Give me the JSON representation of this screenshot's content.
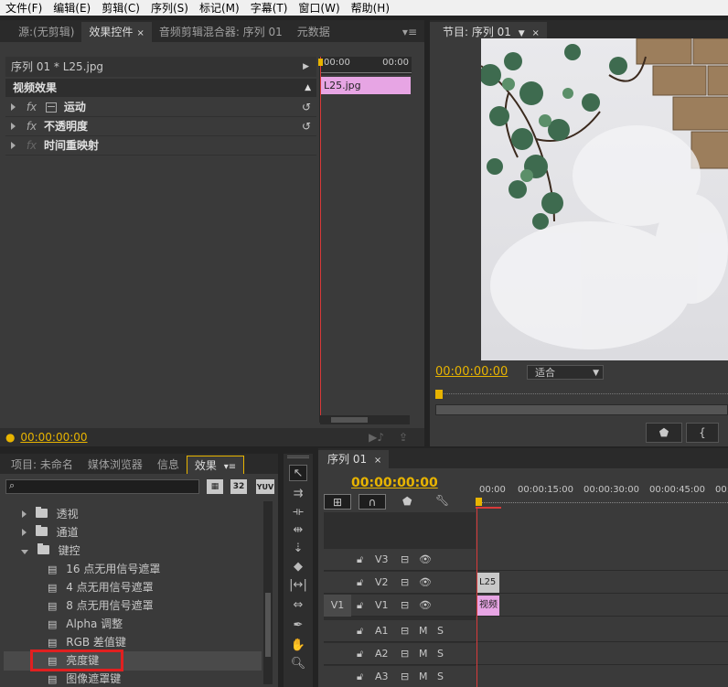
{
  "menu": [
    "文件(F)",
    "编辑(E)",
    "剪辑(C)",
    "序列(S)",
    "标记(M)",
    "字幕(T)",
    "窗口(W)",
    "帮助(H)"
  ],
  "source_panel": {
    "tabs": [
      "源:(无剪辑)",
      "效果控件",
      "音频剪辑混合器: 序列 01",
      "元数据"
    ],
    "clip_path": "序列 01 * L25.jpg",
    "ruler_start": "00:00",
    "ruler_end": "00:00",
    "clip_label": "L25.jpg",
    "video_effects_header": "视频效果",
    "effects": [
      "运动",
      "不透明度",
      "时间重映射"
    ],
    "fx_label": "fx",
    "timecode": "00:00:00:00"
  },
  "program_panel": {
    "tab": "节目: 序列 01",
    "timecode": "00:00:00:00",
    "fit_option": "适合"
  },
  "project_panel": {
    "tabs": [
      "项目: 未命名",
      "媒体浏览器",
      "信息",
      "效果"
    ],
    "search_placeholder": "",
    "badges": [
      "32",
      "YUV"
    ],
    "tree": [
      {
        "label": "透视",
        "type": "folder",
        "expanded": false
      },
      {
        "label": "通道",
        "type": "folder",
        "expanded": false
      },
      {
        "label": "键控",
        "type": "folder",
        "expanded": true
      },
      {
        "label": "16 点无用信号遮罩",
        "type": "effect"
      },
      {
        "label": "4 点无用信号遮罩",
        "type": "effect"
      },
      {
        "label": "8 点无用信号遮罩",
        "type": "effect"
      },
      {
        "label": "Alpha 调整",
        "type": "effect"
      },
      {
        "label": "RGB 差值键",
        "type": "effect"
      },
      {
        "label": "亮度键",
        "type": "effect",
        "selected": true
      },
      {
        "label": "图像遮罩键",
        "type": "effect"
      }
    ]
  },
  "timeline_panel": {
    "tab": "序列 01",
    "timecode": "00:00:00:00",
    "ruler": [
      "00:00",
      "00:00:15:00",
      "00:00:30:00",
      "00:00:45:00",
      "00:0"
    ],
    "video_tracks": [
      "V3",
      "V2",
      "V1"
    ],
    "audio_tracks": [
      "A1",
      "A2",
      "A3"
    ],
    "source_patch": "V1",
    "clip_v2": "L25",
    "clip_v1": "视频",
    "m_label": "M",
    "s_label": "S"
  },
  "colors": {
    "accent_timecode": "#e8b400",
    "clip_pink": "#e7a5e4",
    "playhead": "#d83a3a",
    "highlight_box": "#e02020"
  }
}
